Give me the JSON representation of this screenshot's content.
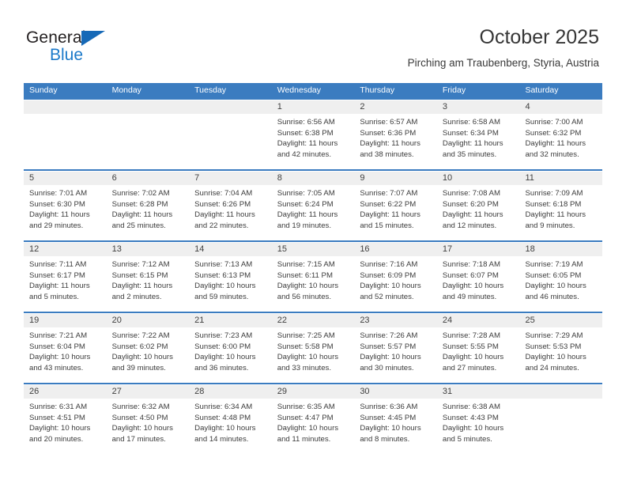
{
  "brand": {
    "name_part1": "General",
    "name_part2": "Blue",
    "triangle_color": "#1669b7",
    "blue_color": "#1b79c9"
  },
  "header": {
    "title": "October 2025",
    "subtitle": "Pirching am Traubenberg, Styria, Austria"
  },
  "theme": {
    "header_blue": "#3b7cc0",
    "date_band_gray": "#efefef",
    "text_color": "#3c3c3c"
  },
  "calendar": {
    "weekday_headers": [
      "Sunday",
      "Monday",
      "Tuesday",
      "Wednesday",
      "Thursday",
      "Friday",
      "Saturday"
    ],
    "weeks": [
      {
        "days": [
          {
            "num": "",
            "lines": [
              "",
              "",
              "",
              ""
            ]
          },
          {
            "num": "",
            "lines": [
              "",
              "",
              "",
              ""
            ]
          },
          {
            "num": "",
            "lines": [
              "",
              "",
              "",
              ""
            ]
          },
          {
            "num": "1",
            "lines": [
              "Sunrise: 6:56 AM",
              "Sunset: 6:38 PM",
              "Daylight: 11 hours",
              "and 42 minutes."
            ]
          },
          {
            "num": "2",
            "lines": [
              "Sunrise: 6:57 AM",
              "Sunset: 6:36 PM",
              "Daylight: 11 hours",
              "and 38 minutes."
            ]
          },
          {
            "num": "3",
            "lines": [
              "Sunrise: 6:58 AM",
              "Sunset: 6:34 PM",
              "Daylight: 11 hours",
              "and 35 minutes."
            ]
          },
          {
            "num": "4",
            "lines": [
              "Sunrise: 7:00 AM",
              "Sunset: 6:32 PM",
              "Daylight: 11 hours",
              "and 32 minutes."
            ]
          }
        ]
      },
      {
        "days": [
          {
            "num": "5",
            "lines": [
              "Sunrise: 7:01 AM",
              "Sunset: 6:30 PM",
              "Daylight: 11 hours",
              "and 29 minutes."
            ]
          },
          {
            "num": "6",
            "lines": [
              "Sunrise: 7:02 AM",
              "Sunset: 6:28 PM",
              "Daylight: 11 hours",
              "and 25 minutes."
            ]
          },
          {
            "num": "7",
            "lines": [
              "Sunrise: 7:04 AM",
              "Sunset: 6:26 PM",
              "Daylight: 11 hours",
              "and 22 minutes."
            ]
          },
          {
            "num": "8",
            "lines": [
              "Sunrise: 7:05 AM",
              "Sunset: 6:24 PM",
              "Daylight: 11 hours",
              "and 19 minutes."
            ]
          },
          {
            "num": "9",
            "lines": [
              "Sunrise: 7:07 AM",
              "Sunset: 6:22 PM",
              "Daylight: 11 hours",
              "and 15 minutes."
            ]
          },
          {
            "num": "10",
            "lines": [
              "Sunrise: 7:08 AM",
              "Sunset: 6:20 PM",
              "Daylight: 11 hours",
              "and 12 minutes."
            ]
          },
          {
            "num": "11",
            "lines": [
              "Sunrise: 7:09 AM",
              "Sunset: 6:18 PM",
              "Daylight: 11 hours",
              "and 9 minutes."
            ]
          }
        ]
      },
      {
        "days": [
          {
            "num": "12",
            "lines": [
              "Sunrise: 7:11 AM",
              "Sunset: 6:17 PM",
              "Daylight: 11 hours",
              "and 5 minutes."
            ]
          },
          {
            "num": "13",
            "lines": [
              "Sunrise: 7:12 AM",
              "Sunset: 6:15 PM",
              "Daylight: 11 hours",
              "and 2 minutes."
            ]
          },
          {
            "num": "14",
            "lines": [
              "Sunrise: 7:13 AM",
              "Sunset: 6:13 PM",
              "Daylight: 10 hours",
              "and 59 minutes."
            ]
          },
          {
            "num": "15",
            "lines": [
              "Sunrise: 7:15 AM",
              "Sunset: 6:11 PM",
              "Daylight: 10 hours",
              "and 56 minutes."
            ]
          },
          {
            "num": "16",
            "lines": [
              "Sunrise: 7:16 AM",
              "Sunset: 6:09 PM",
              "Daylight: 10 hours",
              "and 52 minutes."
            ]
          },
          {
            "num": "17",
            "lines": [
              "Sunrise: 7:18 AM",
              "Sunset: 6:07 PM",
              "Daylight: 10 hours",
              "and 49 minutes."
            ]
          },
          {
            "num": "18",
            "lines": [
              "Sunrise: 7:19 AM",
              "Sunset: 6:05 PM",
              "Daylight: 10 hours",
              "and 46 minutes."
            ]
          }
        ]
      },
      {
        "days": [
          {
            "num": "19",
            "lines": [
              "Sunrise: 7:21 AM",
              "Sunset: 6:04 PM",
              "Daylight: 10 hours",
              "and 43 minutes."
            ]
          },
          {
            "num": "20",
            "lines": [
              "Sunrise: 7:22 AM",
              "Sunset: 6:02 PM",
              "Daylight: 10 hours",
              "and 39 minutes."
            ]
          },
          {
            "num": "21",
            "lines": [
              "Sunrise: 7:23 AM",
              "Sunset: 6:00 PM",
              "Daylight: 10 hours",
              "and 36 minutes."
            ]
          },
          {
            "num": "22",
            "lines": [
              "Sunrise: 7:25 AM",
              "Sunset: 5:58 PM",
              "Daylight: 10 hours",
              "and 33 minutes."
            ]
          },
          {
            "num": "23",
            "lines": [
              "Sunrise: 7:26 AM",
              "Sunset: 5:57 PM",
              "Daylight: 10 hours",
              "and 30 minutes."
            ]
          },
          {
            "num": "24",
            "lines": [
              "Sunrise: 7:28 AM",
              "Sunset: 5:55 PM",
              "Daylight: 10 hours",
              "and 27 minutes."
            ]
          },
          {
            "num": "25",
            "lines": [
              "Sunrise: 7:29 AM",
              "Sunset: 5:53 PM",
              "Daylight: 10 hours",
              "and 24 minutes."
            ]
          }
        ]
      },
      {
        "days": [
          {
            "num": "26",
            "lines": [
              "Sunrise: 6:31 AM",
              "Sunset: 4:51 PM",
              "Daylight: 10 hours",
              "and 20 minutes."
            ]
          },
          {
            "num": "27",
            "lines": [
              "Sunrise: 6:32 AM",
              "Sunset: 4:50 PM",
              "Daylight: 10 hours",
              "and 17 minutes."
            ]
          },
          {
            "num": "28",
            "lines": [
              "Sunrise: 6:34 AM",
              "Sunset: 4:48 PM",
              "Daylight: 10 hours",
              "and 14 minutes."
            ]
          },
          {
            "num": "29",
            "lines": [
              "Sunrise: 6:35 AM",
              "Sunset: 4:47 PM",
              "Daylight: 10 hours",
              "and 11 minutes."
            ]
          },
          {
            "num": "30",
            "lines": [
              "Sunrise: 6:36 AM",
              "Sunset: 4:45 PM",
              "Daylight: 10 hours",
              "and 8 minutes."
            ]
          },
          {
            "num": "31",
            "lines": [
              "Sunrise: 6:38 AM",
              "Sunset: 4:43 PM",
              "Daylight: 10 hours",
              "and 5 minutes."
            ]
          },
          {
            "num": "",
            "lines": [
              "",
              "",
              "",
              ""
            ]
          }
        ]
      }
    ]
  }
}
